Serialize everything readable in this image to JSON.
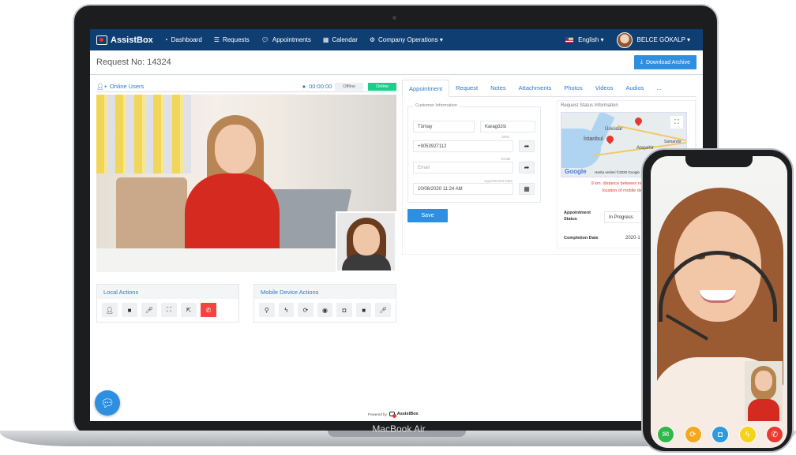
{
  "app": {
    "brand": "AssistBox",
    "nav": [
      "Dashboard",
      "Requests",
      "Appointments",
      "Calendar",
      "Company Operations ▾"
    ],
    "language": "English ▾",
    "user": "BELCE GÖKALP ▾"
  },
  "header": {
    "title": "Request No: 14324",
    "download_label": "Download Archive"
  },
  "video_panel": {
    "title": "Online Users",
    "timer": "00:00:00",
    "offline": "Offline",
    "online": "Online"
  },
  "local_actions": {
    "title": "Local Actions"
  },
  "mobile_actions": {
    "title": "Mobile Device Actions"
  },
  "tabs": [
    "Appointment",
    "Request",
    "Notes",
    "Attachments",
    "Photos",
    "Videos",
    "Audios",
    "..."
  ],
  "customer": {
    "legend": "Customer Information",
    "first_name": "Tümay",
    "last_name": "Karagözlü",
    "phone_label": "SMS",
    "phone": "+9053927112",
    "email_label": "Email",
    "email_placeholder": "Email",
    "date_label": "Appointment Date",
    "date": "10/08/2020 11:24 AM",
    "save_label": "Save"
  },
  "status": {
    "title": "Request Status Information",
    "map_labels": [
      "Üsküdar",
      "İstanbul",
      "Ataşehir",
      "Samandır"
    ],
    "map_data": "Harita verileri ©2020 Google",
    "google": "Google",
    "distance_line1": "9 km. distance between request f",
    "distance_line2": "location of mobile dev",
    "appointment_status_label": "Appointment Status",
    "appointment_status_value": "In Progress",
    "completion_date_label": "Completion Date",
    "completion_date_value": "2020-1"
  },
  "footer": {
    "powered_by": "Powered by",
    "brand": "AssistBox"
  },
  "device": {
    "laptop_label": "MacBook Air"
  },
  "colors": {
    "navbar": "#0f3e73",
    "accent": "#2e8fe0",
    "online": "#19d08a",
    "danger": "#f0463f"
  }
}
